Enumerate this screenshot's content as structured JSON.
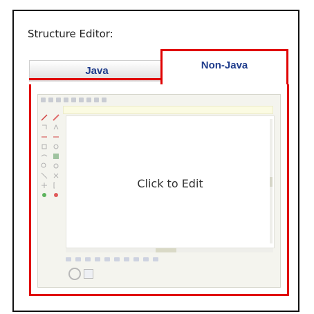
{
  "heading": "Structure Editor:",
  "tabs": [
    {
      "label": "Java",
      "selected": false
    },
    {
      "label": "Non-Java",
      "selected": true
    }
  ],
  "editor": {
    "placeholder": "Click to Edit"
  },
  "colors": {
    "highlight": "#e00000",
    "tab_text": "#1f3c8c"
  }
}
